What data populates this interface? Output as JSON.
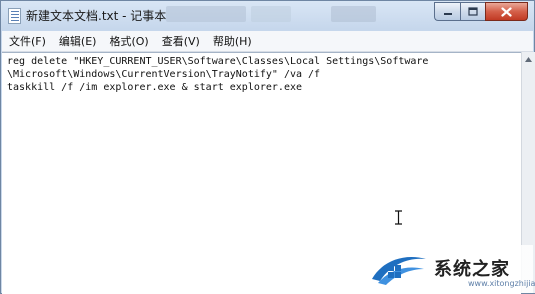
{
  "window": {
    "title": "新建文本文档.txt - 记事本",
    "icon": "notepad-icon"
  },
  "menu": {
    "items": [
      {
        "label": "文件(F)"
      },
      {
        "label": "编辑(E)"
      },
      {
        "label": "格式(O)"
      },
      {
        "label": "查看(V)"
      },
      {
        "label": "帮助(H)"
      }
    ]
  },
  "editor": {
    "text": "reg delete \"HKEY_CURRENT_USER\\Software\\Classes\\Local Settings\\Software\n\\Microsoft\\Windows\\CurrentVersion\\TrayNotify\" /va /f\ntaskkill /f /im explorer.exe & start explorer.exe"
  },
  "watermark": {
    "text": "系统之家",
    "url": "www.xitongzhijia.net",
    "accent": "#1f6fc0"
  },
  "colors": {
    "titlebar": "#c6d7ec",
    "close_button": "#c13a24"
  }
}
